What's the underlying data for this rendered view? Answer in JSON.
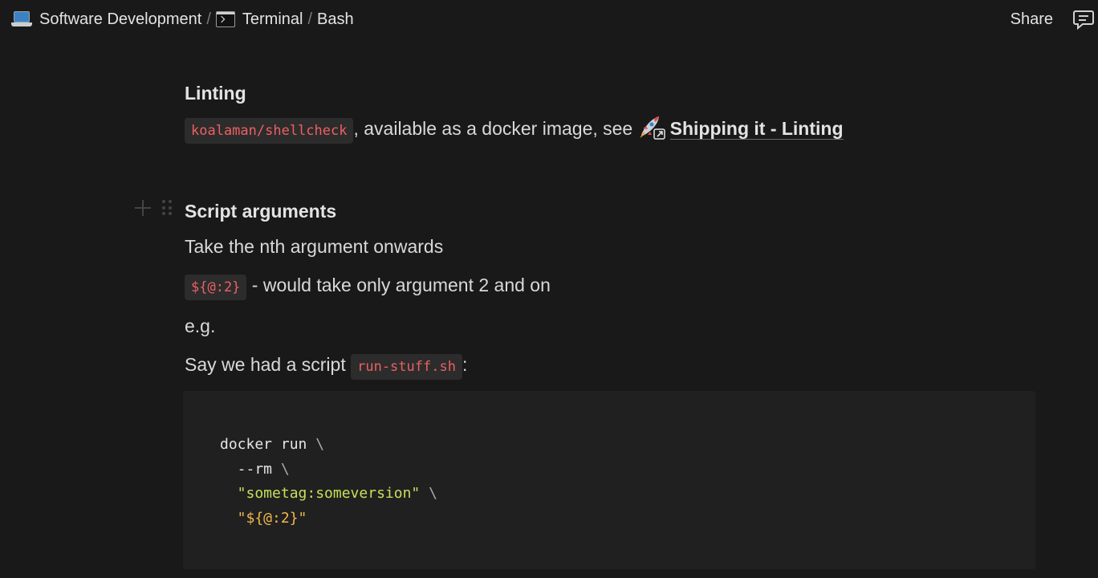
{
  "breadcrumb": {
    "items": [
      {
        "icon": "laptop-icon",
        "label": "Software Development"
      },
      {
        "icon": "terminal-icon",
        "label": "Terminal"
      },
      {
        "icon": "",
        "label": "Bash"
      }
    ],
    "separator": "/"
  },
  "header": {
    "share_label": "Share",
    "comment_icon": "comment-icon"
  },
  "content": {
    "linting": {
      "heading": "Linting",
      "code": "koalaman/shellcheck",
      "text": ", available as a docker image, see ",
      "link_icon": "rocket-icon",
      "link_label": "Shipping it - Linting"
    },
    "script_args": {
      "heading": "Script arguments",
      "line1": "Take the nth argument onwards",
      "line2_code": "${@:2}",
      "line2_text": " - would take only argument 2 and on",
      "line3": "e.g.",
      "line4_text": "Say we had a script ",
      "line4_code": "run-stuff.sh",
      "line4_end": ":"
    },
    "code_block": {
      "lines": [
        {
          "a": "docker run ",
          "b": "\\"
        },
        {
          "a": "  --rm ",
          "b": "\\"
        },
        {
          "str": "  \"sometag:someversion\"",
          "b": " \\"
        },
        {
          "str2": "  \"${@:2}\""
        }
      ]
    }
  },
  "colors": {
    "background": "#191919",
    "inline_code": "#ec6062",
    "string_green": "#c5e05a",
    "string_orange": "#f1b84c"
  }
}
